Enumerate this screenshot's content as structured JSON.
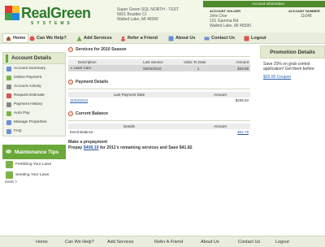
{
  "brand": {
    "title": "RealGreen",
    "subtitle": "SYSTEMS",
    "accent": "#2f7a2c"
  },
  "company": {
    "name": "Super Green SQL NORTH - TEST",
    "address": "6601 Boulder Ct",
    "city": "Walled Lake, MI 48390"
  },
  "account_info": {
    "title": "Account Information",
    "holder_label": "ACCOUNT HOLDER",
    "number_label": "ACCOUNT NUMBER",
    "holder_name": "John Doe",
    "holder_address": "101 Gamma Rd",
    "holder_city": "Walled Lake, MI 48390",
    "account_number": "11648"
  },
  "nav": [
    {
      "label": "Home",
      "icon": "home-icon"
    },
    {
      "label": "Can We Help?",
      "icon": "help-icon"
    },
    {
      "label": "Add Services",
      "icon": "add-services-icon"
    },
    {
      "label": "Refer a Friend",
      "icon": "refer-icon"
    },
    {
      "label": "About Us",
      "icon": "about-icon"
    },
    {
      "label": "Contact Us",
      "icon": "contact-icon"
    },
    {
      "label": "Logout",
      "icon": "logout-icon"
    }
  ],
  "sidebar": {
    "title": "Account Details",
    "items": [
      {
        "label": "Account Summary",
        "icon": "summary-icon",
        "color": "#6b8fd6"
      },
      {
        "label": "Online Payment",
        "icon": "payment-icon",
        "color": "#7db24a"
      },
      {
        "label": "Account Activity",
        "icon": "activity-icon",
        "color": "#8a8a8a"
      },
      {
        "label": "Request Estimate",
        "icon": "estimate-icon",
        "color": "#d9534f"
      },
      {
        "label": "Payment History",
        "icon": "history-icon",
        "color": "#8a8a8a"
      },
      {
        "label": "Auto Pay",
        "icon": "autopay-icon",
        "color": "#7db24a"
      },
      {
        "label": "Manage Properties",
        "icon": "properties-icon",
        "color": "#6b8fd6"
      },
      {
        "label": "FAQ",
        "icon": "faq-icon",
        "color": "#6b8fd6"
      }
    ],
    "tips_title": "Maintenance Tips",
    "tips": [
      {
        "label": "Fertilizing Your Lawn"
      },
      {
        "label": "Seeding Your Lawn"
      }
    ],
    "more": "more >"
  },
  "services": {
    "title": "Services for 2010 Season",
    "headers": [
      "Description",
      "Last Service",
      "Visits To Date",
      "Amount"
    ],
    "rows": [
      {
        "description": "Lawn Care",
        "last_service": "06/02/2010",
        "visits": "1",
        "amount": "$29.99"
      }
    ]
  },
  "payments": {
    "title": "Payment Details",
    "headers": [
      "Last Payment Date",
      "Amount"
    ],
    "rows": [
      {
        "date": "11/04/2010",
        "amount": "$208.93"
      }
    ]
  },
  "balance": {
    "title": "Current Balance",
    "headers": [
      "Details",
      "Amount"
    ],
    "rows": [
      {
        "details": "Itemit Balance",
        "amount": "$31.79"
      }
    ]
  },
  "prepayment": {
    "line1": "Make a prepayment",
    "prefix": "Prepay ",
    "amount": "$408.19",
    "suffix": " for 2011's remaining services and Save $41.82"
  },
  "promotion": {
    "title": "Promotion Details",
    "text": "Save 20% on grub control application! Get them before",
    "link": "$25.00 Coupon"
  },
  "footer": [
    "Home",
    "Can We Help?",
    "Add Services",
    "Refer A Friend",
    "About Us",
    "Contact Us",
    "Logout"
  ]
}
